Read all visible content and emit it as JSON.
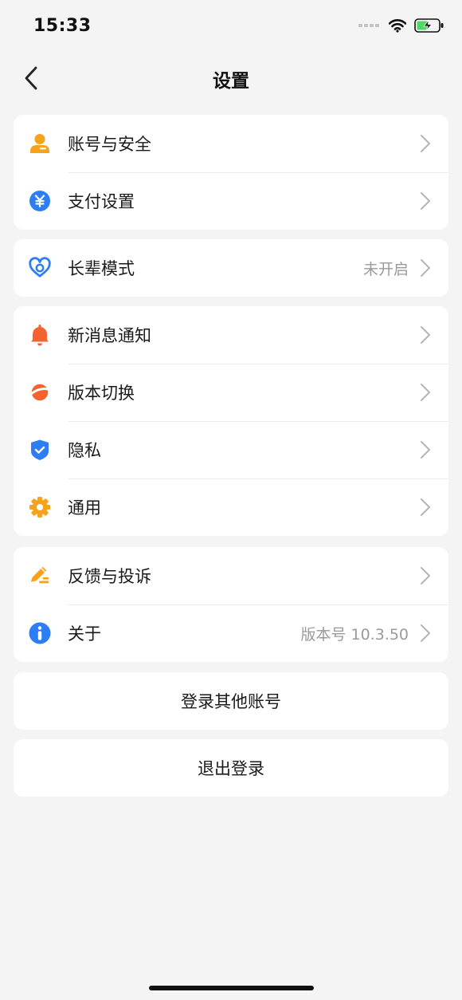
{
  "status_bar": {
    "time": "15:33"
  },
  "header": {
    "title": "设置"
  },
  "groups": [
    {
      "items": [
        {
          "icon": "user-icon",
          "label": "账号与安全",
          "value": ""
        },
        {
          "icon": "yuan-icon",
          "label": "支付设置",
          "value": ""
        }
      ]
    },
    {
      "items": [
        {
          "icon": "heart-icon",
          "label": "长辈模式",
          "value": "未开启"
        }
      ]
    },
    {
      "items": [
        {
          "icon": "bell-icon",
          "label": "新消息通知",
          "value": ""
        },
        {
          "icon": "planet-icon",
          "label": "版本切换",
          "value": ""
        },
        {
          "icon": "shield-icon",
          "label": "隐私",
          "value": ""
        },
        {
          "icon": "gear-icon",
          "label": "通用",
          "value": ""
        }
      ]
    },
    {
      "items": [
        {
          "icon": "pencil-icon",
          "label": "反馈与投诉",
          "value": ""
        },
        {
          "icon": "info-icon",
          "label": "关于",
          "value": "版本号 10.3.50"
        }
      ]
    }
  ],
  "actions": {
    "switch_account": "登录其他账号",
    "logout": "退出登录"
  },
  "colors": {
    "background": "#f4f4f4",
    "orange": "#f7a21b",
    "blue": "#2d7ef5",
    "red_orange": "#f4622f",
    "battery_green": "#4cd964"
  }
}
